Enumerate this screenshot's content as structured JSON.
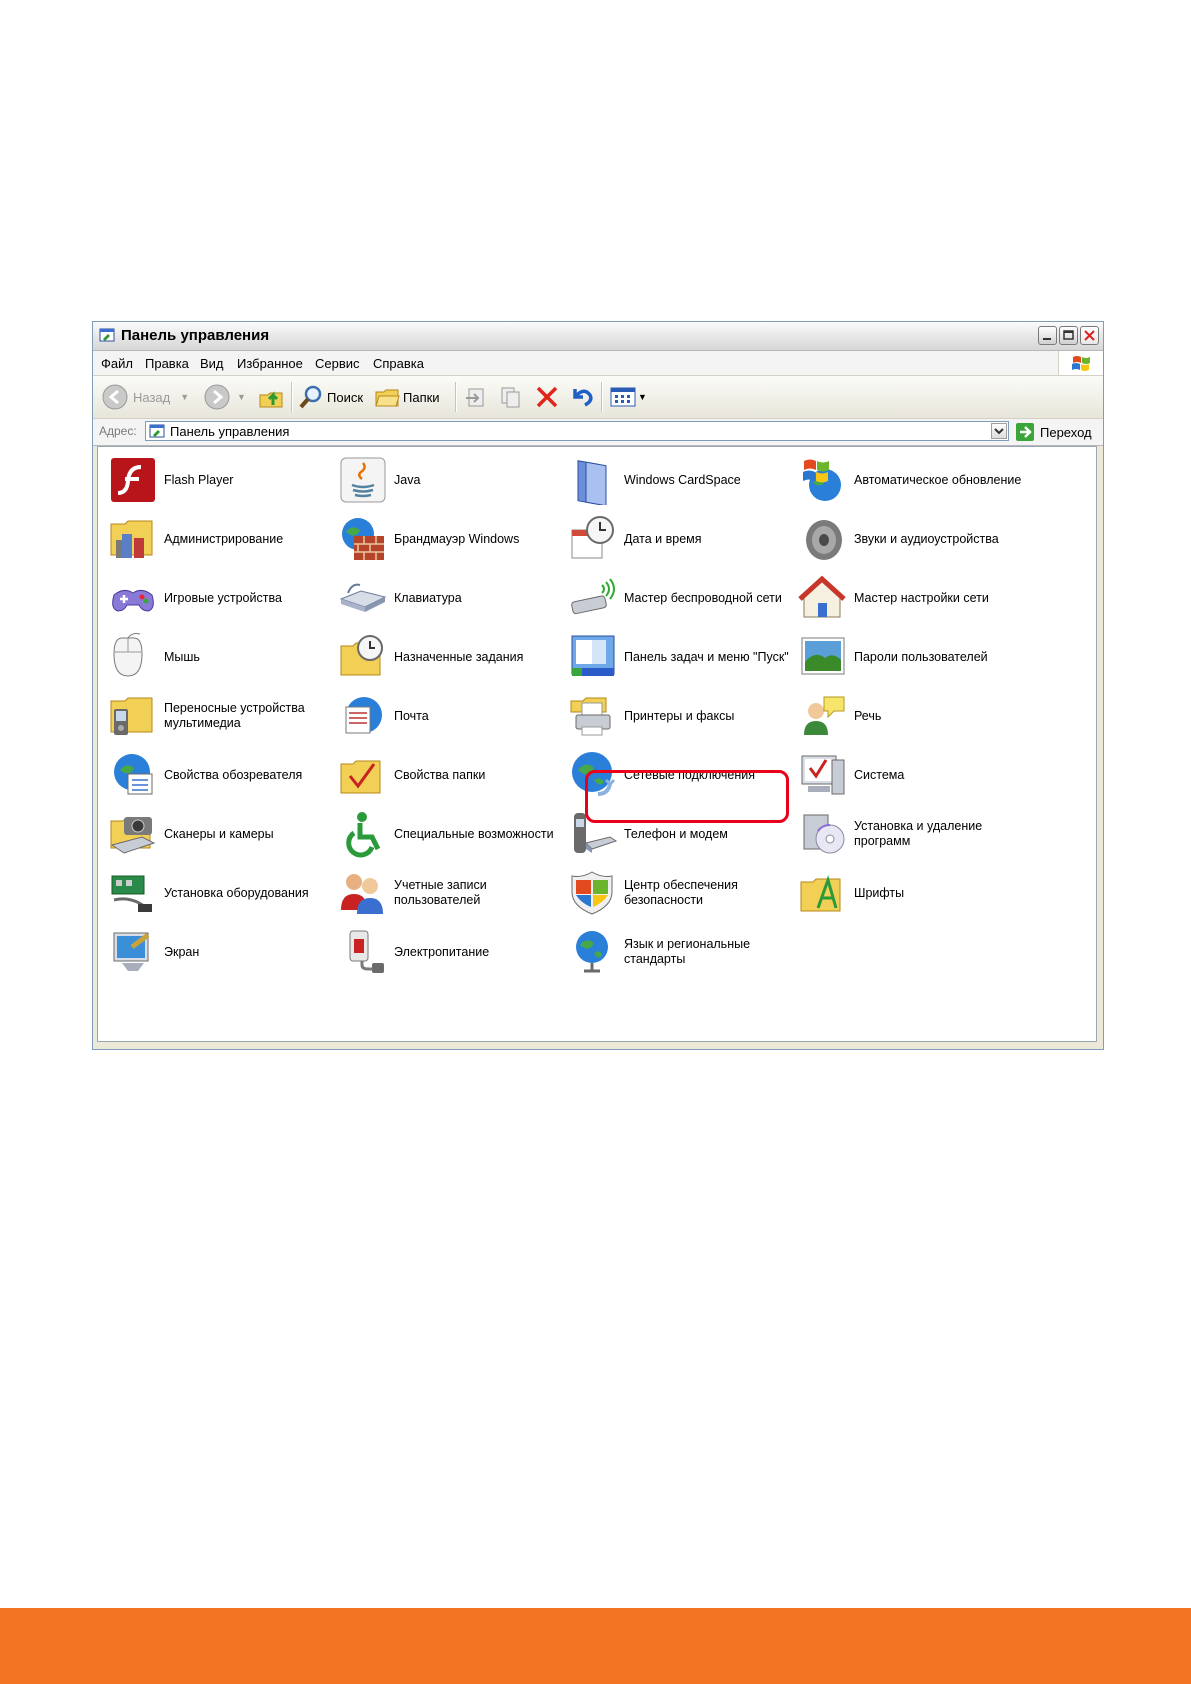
{
  "window": {
    "title": "Панель управления"
  },
  "menu": [
    "Файл",
    "Правка",
    "Вид",
    "Избранное",
    "Сервис",
    "Справка"
  ],
  "toolbar": {
    "back_label": "Назад",
    "search_label": "Поиск",
    "folders_label": "Папки"
  },
  "address": {
    "label": "Адрес:",
    "value": "Панель управления",
    "go_label": "Переход"
  },
  "items": [
    {
      "label": "Flash Player",
      "icon": "flash-player-icon"
    },
    {
      "label": "Java",
      "icon": "java-icon"
    },
    {
      "label": "Windows CardSpace",
      "icon": "cardspace-icon"
    },
    {
      "label": "Автоматическое обновление",
      "icon": "auto-update-icon"
    },
    {
      "label": "Администрирование",
      "icon": "admin-tools-icon"
    },
    {
      "label": "Брандмауэр Windows",
      "icon": "firewall-icon"
    },
    {
      "label": "Дата и время",
      "icon": "date-time-icon"
    },
    {
      "label": "Звуки и аудиоустройства",
      "icon": "speaker-icon"
    },
    {
      "label": "Игровые устройства",
      "icon": "gamepad-icon"
    },
    {
      "label": "Клавиатура",
      "icon": "keyboard-icon"
    },
    {
      "label": "Мастер беспроводной сети",
      "icon": "wireless-icon"
    },
    {
      "label": "Мастер настройки сети",
      "icon": "home-network-icon"
    },
    {
      "label": "Мышь",
      "icon": "mouse-icon"
    },
    {
      "label": "Назначенные задания",
      "icon": "scheduled-tasks-icon"
    },
    {
      "label": "Панель задач и меню \"Пуск\"",
      "icon": "taskbar-icon"
    },
    {
      "label": "Пароли пользователей",
      "icon": "user-passwords-icon"
    },
    {
      "label": "Переносные устройства\nмультимедиа",
      "icon": "portable-devices-icon"
    },
    {
      "label": "Почта",
      "icon": "mail-icon"
    },
    {
      "label": "Принтеры и факсы",
      "icon": "printer-icon"
    },
    {
      "label": "Речь",
      "icon": "speech-icon"
    },
    {
      "label": "Свойства обозревателя",
      "icon": "internet-options-icon"
    },
    {
      "label": "Свойства папки",
      "icon": "folder-options-icon"
    },
    {
      "label": "Сетевые подключения",
      "icon": "network-connections-icon"
    },
    {
      "label": "Система",
      "icon": "system-icon"
    },
    {
      "label": "Сканеры и камеры",
      "icon": "scanner-camera-icon"
    },
    {
      "label": "Специальные возможности",
      "icon": "accessibility-icon"
    },
    {
      "label": "Телефон и модем",
      "icon": "phone-modem-icon"
    },
    {
      "label": "Установка и удаление\nпрограмм",
      "icon": "add-remove-programs-icon"
    },
    {
      "label": "Установка оборудования",
      "icon": "add-hardware-icon"
    },
    {
      "label": "Учетные записи\nпользователей",
      "icon": "user-accounts-icon"
    },
    {
      "label": "Центр обеспечения\nбезопасности",
      "icon": "security-center-icon"
    },
    {
      "label": "Шрифты",
      "icon": "fonts-icon"
    },
    {
      "label": "Экран",
      "icon": "display-icon"
    },
    {
      "label": "Электропитание",
      "icon": "power-options-icon"
    },
    {
      "label": "Язык и региональные\nстандарты",
      "icon": "regional-options-icon"
    }
  ],
  "highlighted_item": "Сетевые подключения",
  "colors": {
    "highlight": "#e8001c",
    "footer": "#f47521"
  }
}
